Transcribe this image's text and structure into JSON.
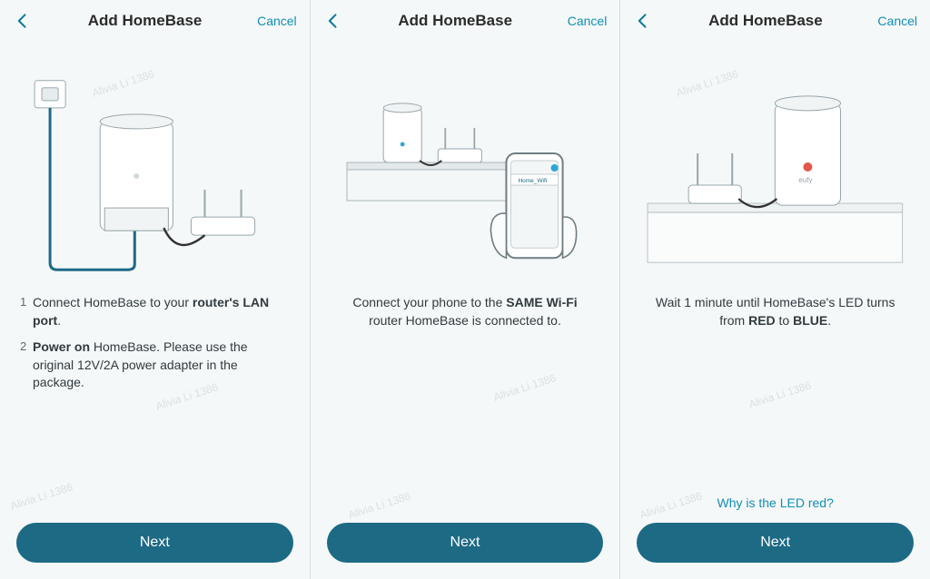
{
  "watermark": "Alivia Li 1386",
  "screens": [
    {
      "title": "Add HomeBase",
      "cancel": "Cancel",
      "next": "Next",
      "step1_prefix": "Connect HomeBase to your ",
      "step1_bold": "router's LAN port",
      "step1_suffix": ".",
      "step2_bold": "Power on",
      "step2_rest": " HomeBase. Please use the original 12V/2A power adapter in the package."
    },
    {
      "title": "Add HomeBase",
      "cancel": "Cancel",
      "next": "Next",
      "line_prefix": "Connect your phone to the ",
      "line_bold": "SAME Wi-Fi",
      "line_rest": " router HomeBase is connected to.",
      "phone_label": "Home_Wifi"
    },
    {
      "title": "Add HomeBase",
      "cancel": "Cancel",
      "next": "Next",
      "line_prefix": "Wait 1 minute until HomeBase's LED turns from ",
      "line_bold1": "RED",
      "line_mid": " to ",
      "line_bold2": "BLUE",
      "line_suffix": ".",
      "helplink": "Why is the LED red?",
      "device_label": "eufy"
    }
  ]
}
